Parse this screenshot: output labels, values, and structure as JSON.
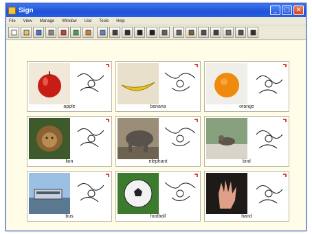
{
  "window": {
    "title": "Sign"
  },
  "menu": [
    "File",
    "View",
    "Manage",
    "Window",
    "Use",
    "Tools",
    "Help"
  ],
  "toolbar_icons": [
    "new-icon",
    "open-icon",
    "save-icon",
    "print-icon",
    "cut-icon",
    "copy-icon",
    "paste-icon",
    "image-icon",
    "camera-icon",
    "arrow-icon",
    "hands-icon",
    "hands-alt-icon",
    "import-icon",
    "export-icon",
    "book-icon",
    "list-icon",
    "grid-icon",
    "frame-icon",
    "settings-icon",
    "stop-icon"
  ],
  "cards": [
    {
      "label": "apple",
      "photo": "apple"
    },
    {
      "label": "banana",
      "photo": "banana"
    },
    {
      "label": "orange",
      "photo": "orange"
    },
    {
      "label": "lion",
      "photo": "lion"
    },
    {
      "label": "elephant",
      "photo": "elephant"
    },
    {
      "label": "bird",
      "photo": "bird"
    },
    {
      "label": "bus",
      "photo": "bus"
    },
    {
      "label": "football",
      "photo": "football"
    },
    {
      "label": "hand",
      "photo": "hand"
    }
  ],
  "colors": {
    "titlebar": "#2a5fe0",
    "content_bg": "#fffde8",
    "accent_red": "#e04040"
  }
}
